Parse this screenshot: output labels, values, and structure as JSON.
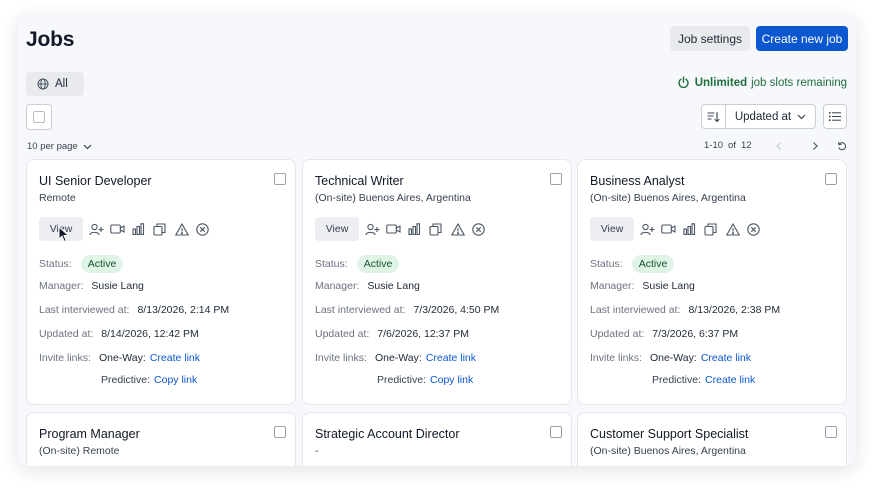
{
  "header": {
    "title": "Jobs",
    "job_settings_label": "Job settings",
    "create_label": "Create new job"
  },
  "filters": {
    "all_label": "All",
    "slots_bold": "Unlimited",
    "slots_rest": "job slots remaining"
  },
  "toolbar": {
    "sort_field": "Updated at",
    "per_page": "10 per page"
  },
  "pagination": {
    "range": "1-10",
    "of_label": "of",
    "total": "12"
  },
  "labels": {
    "view": "View",
    "status": "Status:",
    "manager": "Manager:",
    "last_interviewed": "Last interviewed at:",
    "updated": "Updated at:",
    "invite_links": "Invite links:",
    "one_way": "One-Way:",
    "predictive": "Predictive:"
  },
  "jobs": [
    {
      "title": "UI Senior Developer",
      "location": "Remote",
      "status": "Active",
      "manager": "Susie Lang",
      "last_interviewed": "8/13/2026, 2:14 PM",
      "updated": "8/14/2026, 12:42 PM",
      "one_way_link": "Create link",
      "predictive_link": "Copy link"
    },
    {
      "title": "Technical Writer",
      "location": "(On-site) Buenos Aires, Argentina",
      "status": "Active",
      "manager": "Susie Lang",
      "last_interviewed": "7/3/2026, 4:50 PM",
      "updated": "7/6/2026, 12:37 PM",
      "one_way_link": "Create link",
      "predictive_link": "Copy link"
    },
    {
      "title": "Business Analyst",
      "location": "(On-site) Buenos Aires, Argentina",
      "status": "Active",
      "manager": "Susie Lang",
      "last_interviewed": "8/13/2026, 2:38 PM",
      "updated": "7/3/2026, 6:37 PM",
      "one_way_link": "Create link",
      "predictive_link": "Create link"
    },
    {
      "title": "Program Manager",
      "location": "(On-site) Remote"
    },
    {
      "title": "Strategic Account Director",
      "location": "-"
    },
    {
      "title": "Customer Support Specialist",
      "location": "(On-site) Buenos Aires, Argentina"
    }
  ],
  "icons": {
    "all": "globe-icon",
    "slots": "power-icon",
    "sort_direction": "sort-descending-icon",
    "sort_field": "chevron-down-icon",
    "view_toggle": "list-view-icon",
    "per_page": "chevron-down-icon",
    "prev_page": "chevron-left-icon",
    "next_page": "chevron-right-icon",
    "refresh": "refresh-icon",
    "card_actions": [
      "add-candidate-icon",
      "video-icon",
      "analytics-icon",
      "duplicate-icon",
      "warning-icon",
      "close-circle-icon"
    ]
  },
  "colors": {
    "primary": "#0b57d0",
    "success_text": "#1f6f3d",
    "badge_bg": "#dff3e6",
    "page_bg": "#f7f8fb"
  }
}
